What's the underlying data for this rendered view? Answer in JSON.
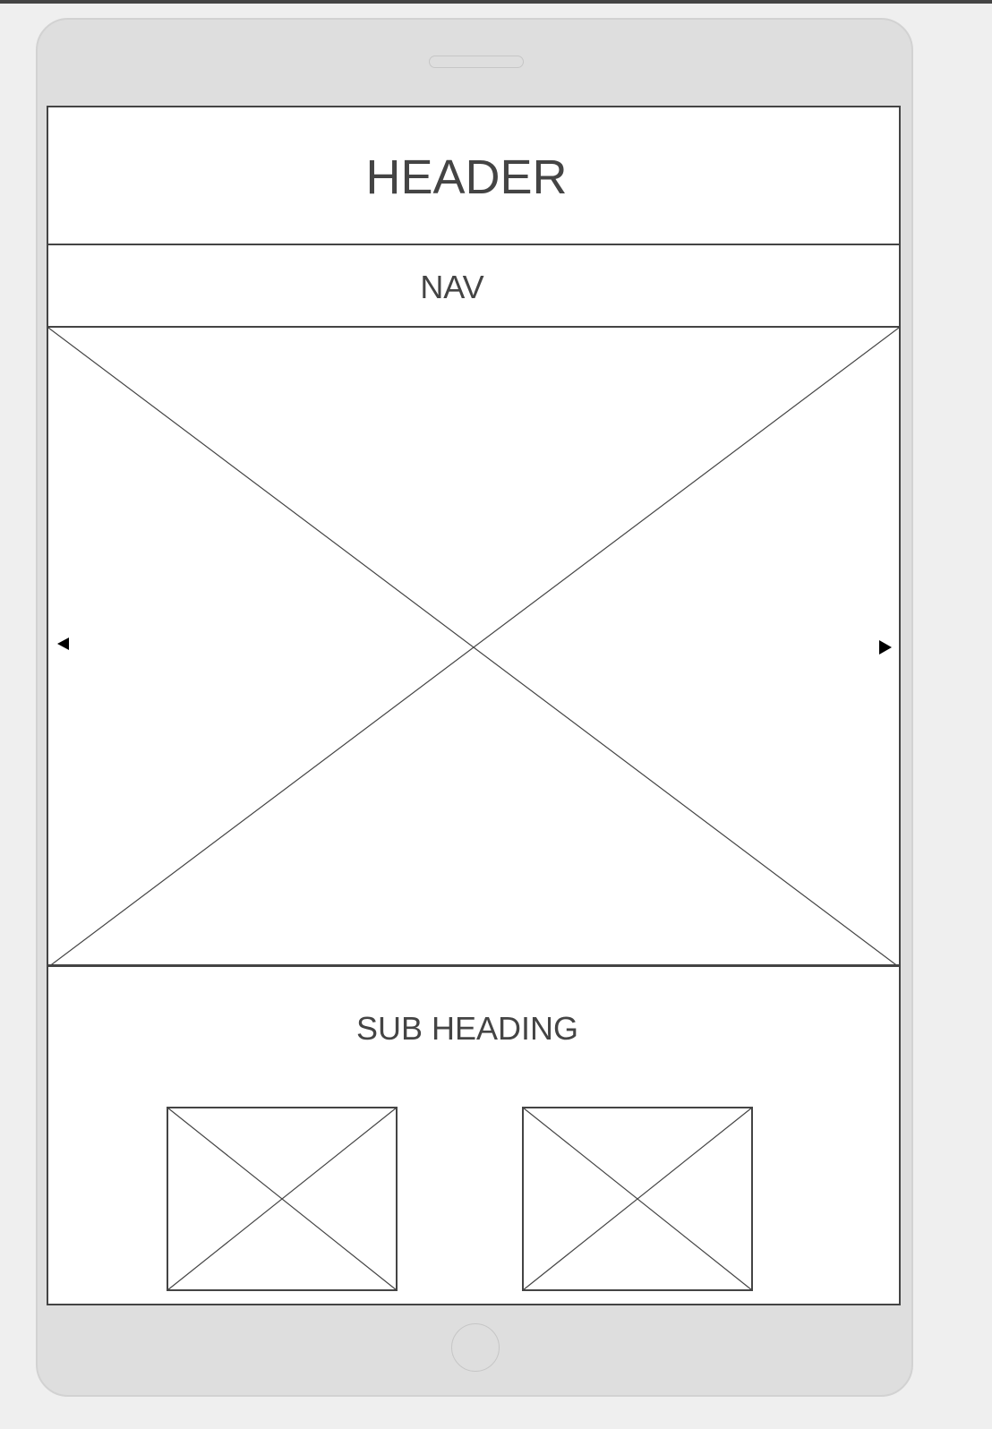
{
  "wireframe": {
    "header": {
      "title": "HEADER"
    },
    "nav": {
      "label": "NAV"
    },
    "content": {
      "sub_heading": "SUB HEADING"
    }
  },
  "colors": {
    "stroke": "#444444",
    "device_body": "#dedede",
    "screen": "#ffffff",
    "background": "#efefef"
  }
}
